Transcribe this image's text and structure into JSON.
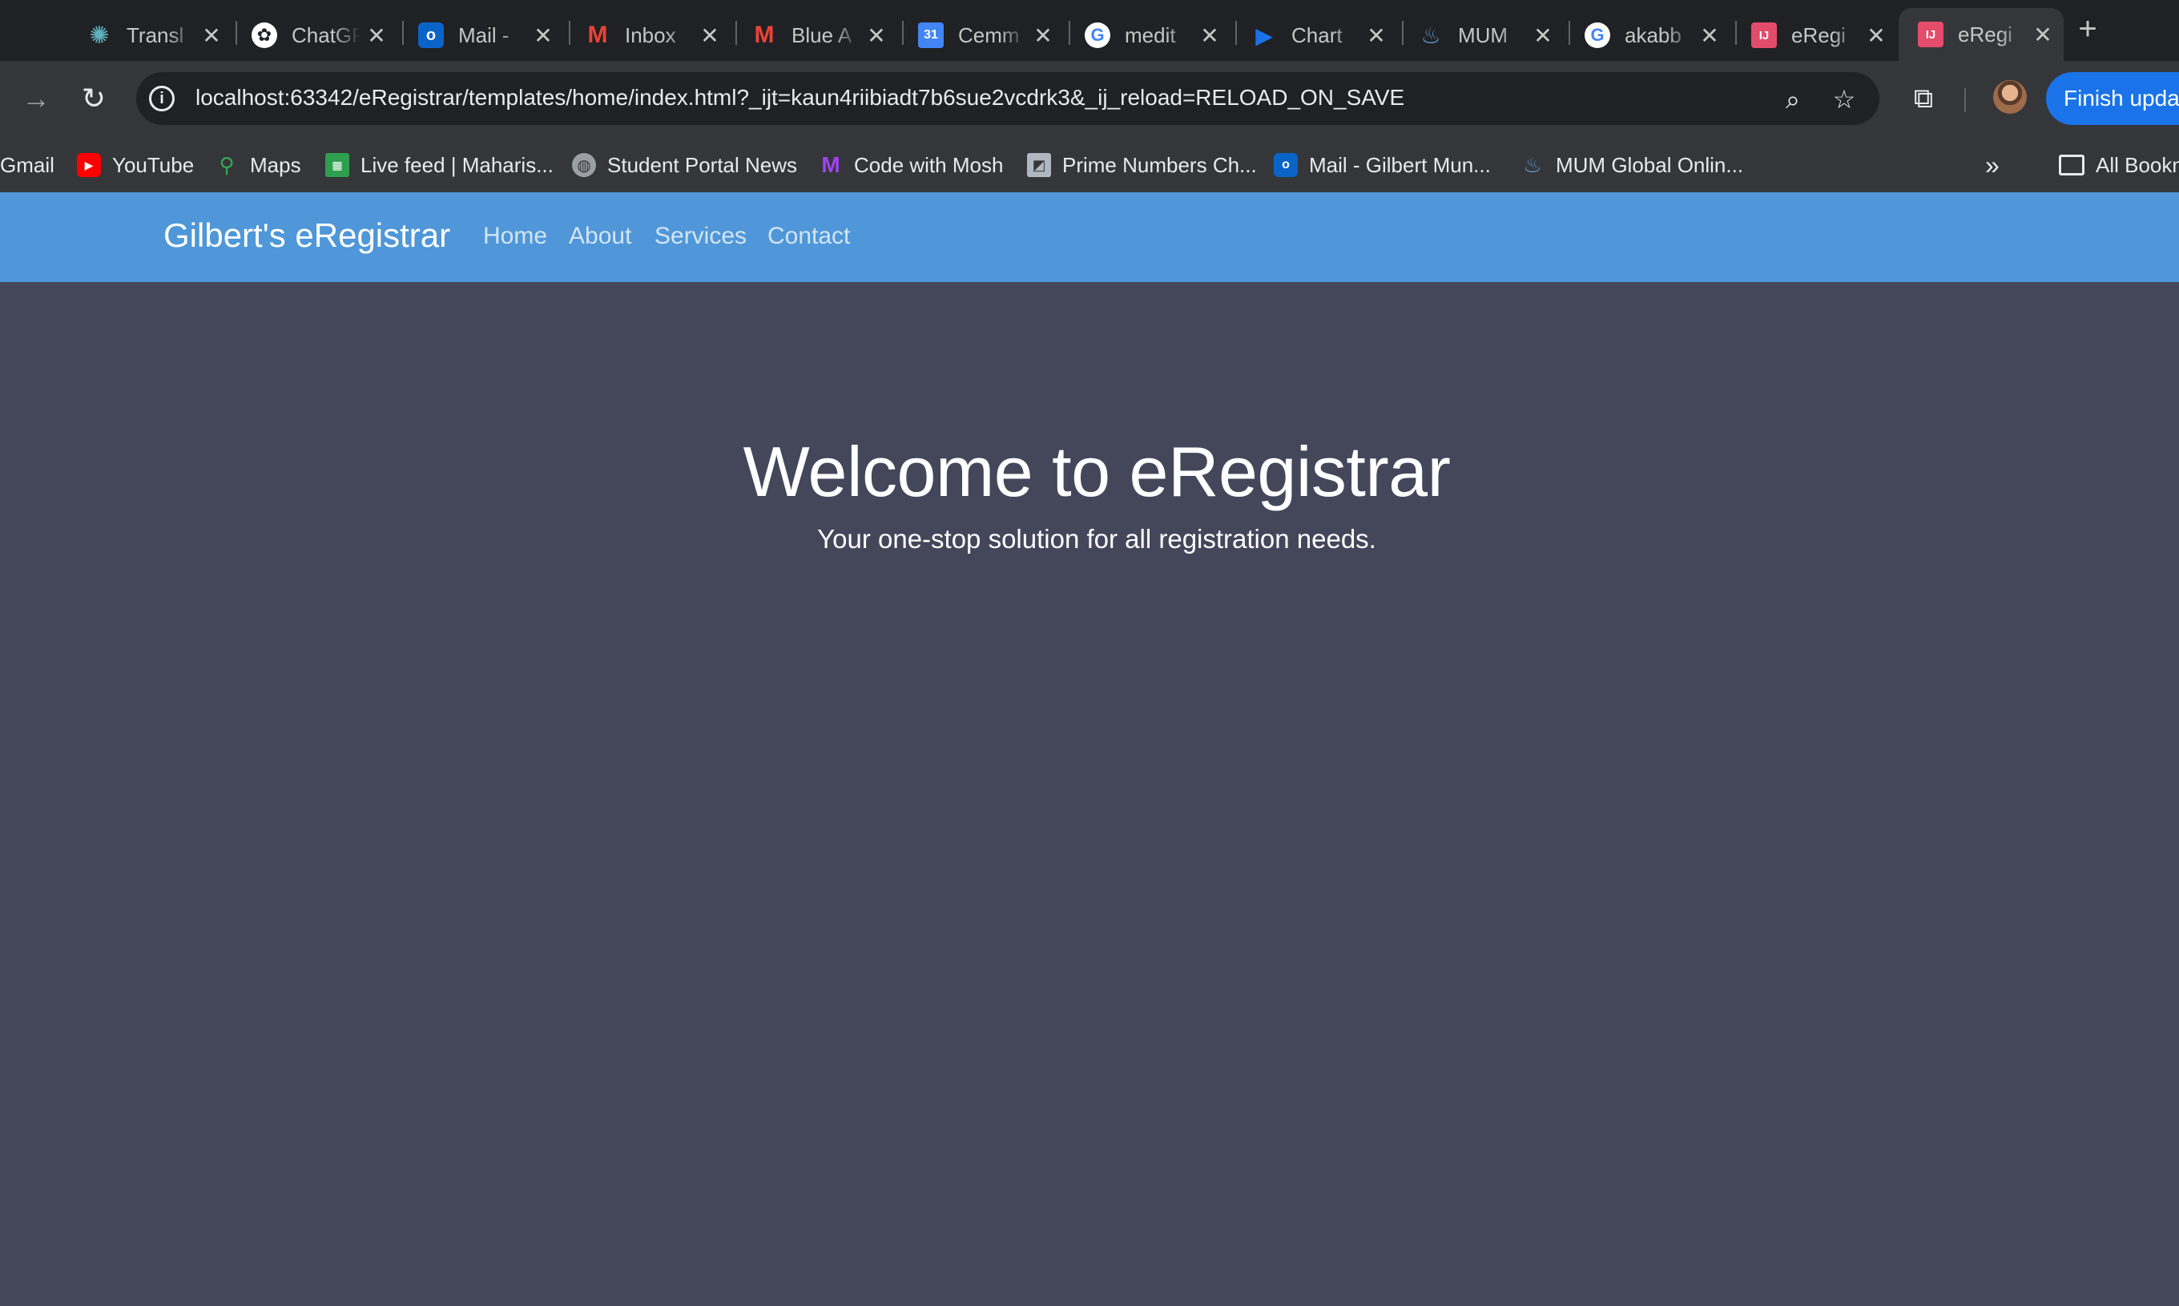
{
  "browser": {
    "tabs": [
      {
        "label": "Transl",
        "icon": "perplexity-icon",
        "color": "#20808d"
      },
      {
        "label": "ChatGPT",
        "icon": "chatgpt-icon",
        "color": "#ffffff"
      },
      {
        "label": "Mail - ",
        "icon": "outlook-icon",
        "color": "#0a64c8"
      },
      {
        "label": "Inbox",
        "icon": "gmail-icon",
        "color": "#ea4335"
      },
      {
        "label": "Blue A",
        "icon": "gmail-icon",
        "color": "#ea4335"
      },
      {
        "label": "Cemm",
        "icon": "calendar-icon",
        "color": "#4285f4"
      },
      {
        "label": "medit",
        "icon": "google-icon",
        "color": "#ffffff"
      },
      {
        "label": "Chart",
        "icon": "play-icon",
        "color": "#1a73e8"
      },
      {
        "label": "MUM",
        "icon": "java-icon",
        "color": "#5b9bd5"
      },
      {
        "label": "akabb",
        "icon": "google-icon",
        "color": "#ffffff"
      },
      {
        "label": "eRegi",
        "icon": "intellij-icon",
        "color": "#e34c6a"
      },
      {
        "label": "eRegi",
        "icon": "intellij-icon",
        "color": "#e34c6a",
        "active": true
      }
    ],
    "url": "localhost:63342/eRegistrar/templates/home/index.html?_ijt=kaun4riibiadt7b6sue2vcdrk3&_ij_reload=RELOAD_ON_SAVE",
    "finish_update_label": "Finish update",
    "bookmarks": [
      {
        "label": "Gmail",
        "icon": "gmail-icon",
        "color": "#ea4335"
      },
      {
        "label": "YouTube",
        "icon": "youtube-icon",
        "color": "#ff0000"
      },
      {
        "label": "Maps",
        "icon": "maps-icon",
        "color": "#34a853"
      },
      {
        "label": "Live feed | Maharis...",
        "icon": "livefeed-icon",
        "color": "#2e9e4f"
      },
      {
        "label": "Student Portal News",
        "icon": "globe-icon",
        "color": "#9aa0a6"
      },
      {
        "label": "Code with Mosh",
        "icon": "mosh-icon",
        "color": "#a142f4"
      },
      {
        "label": "Prime Numbers Ch...",
        "icon": "chart-icon",
        "color": "#b0b7c0"
      },
      {
        "label": "Mail - Gilbert Mun...",
        "icon": "outlook-icon",
        "color": "#0a64c8"
      },
      {
        "label": "MUM Global Onlin...",
        "icon": "java-icon",
        "color": "#5b9bd5"
      }
    ],
    "all_bookmarks_label": "All Bookmarks"
  },
  "site": {
    "brand": "Gilbert's eRegistrar",
    "nav": [
      "Home",
      "About",
      "Services",
      "Contact"
    ],
    "hero": {
      "title": "Welcome to eRegistrar",
      "subtitle": "Your one-stop solution for all registration needs."
    }
  }
}
